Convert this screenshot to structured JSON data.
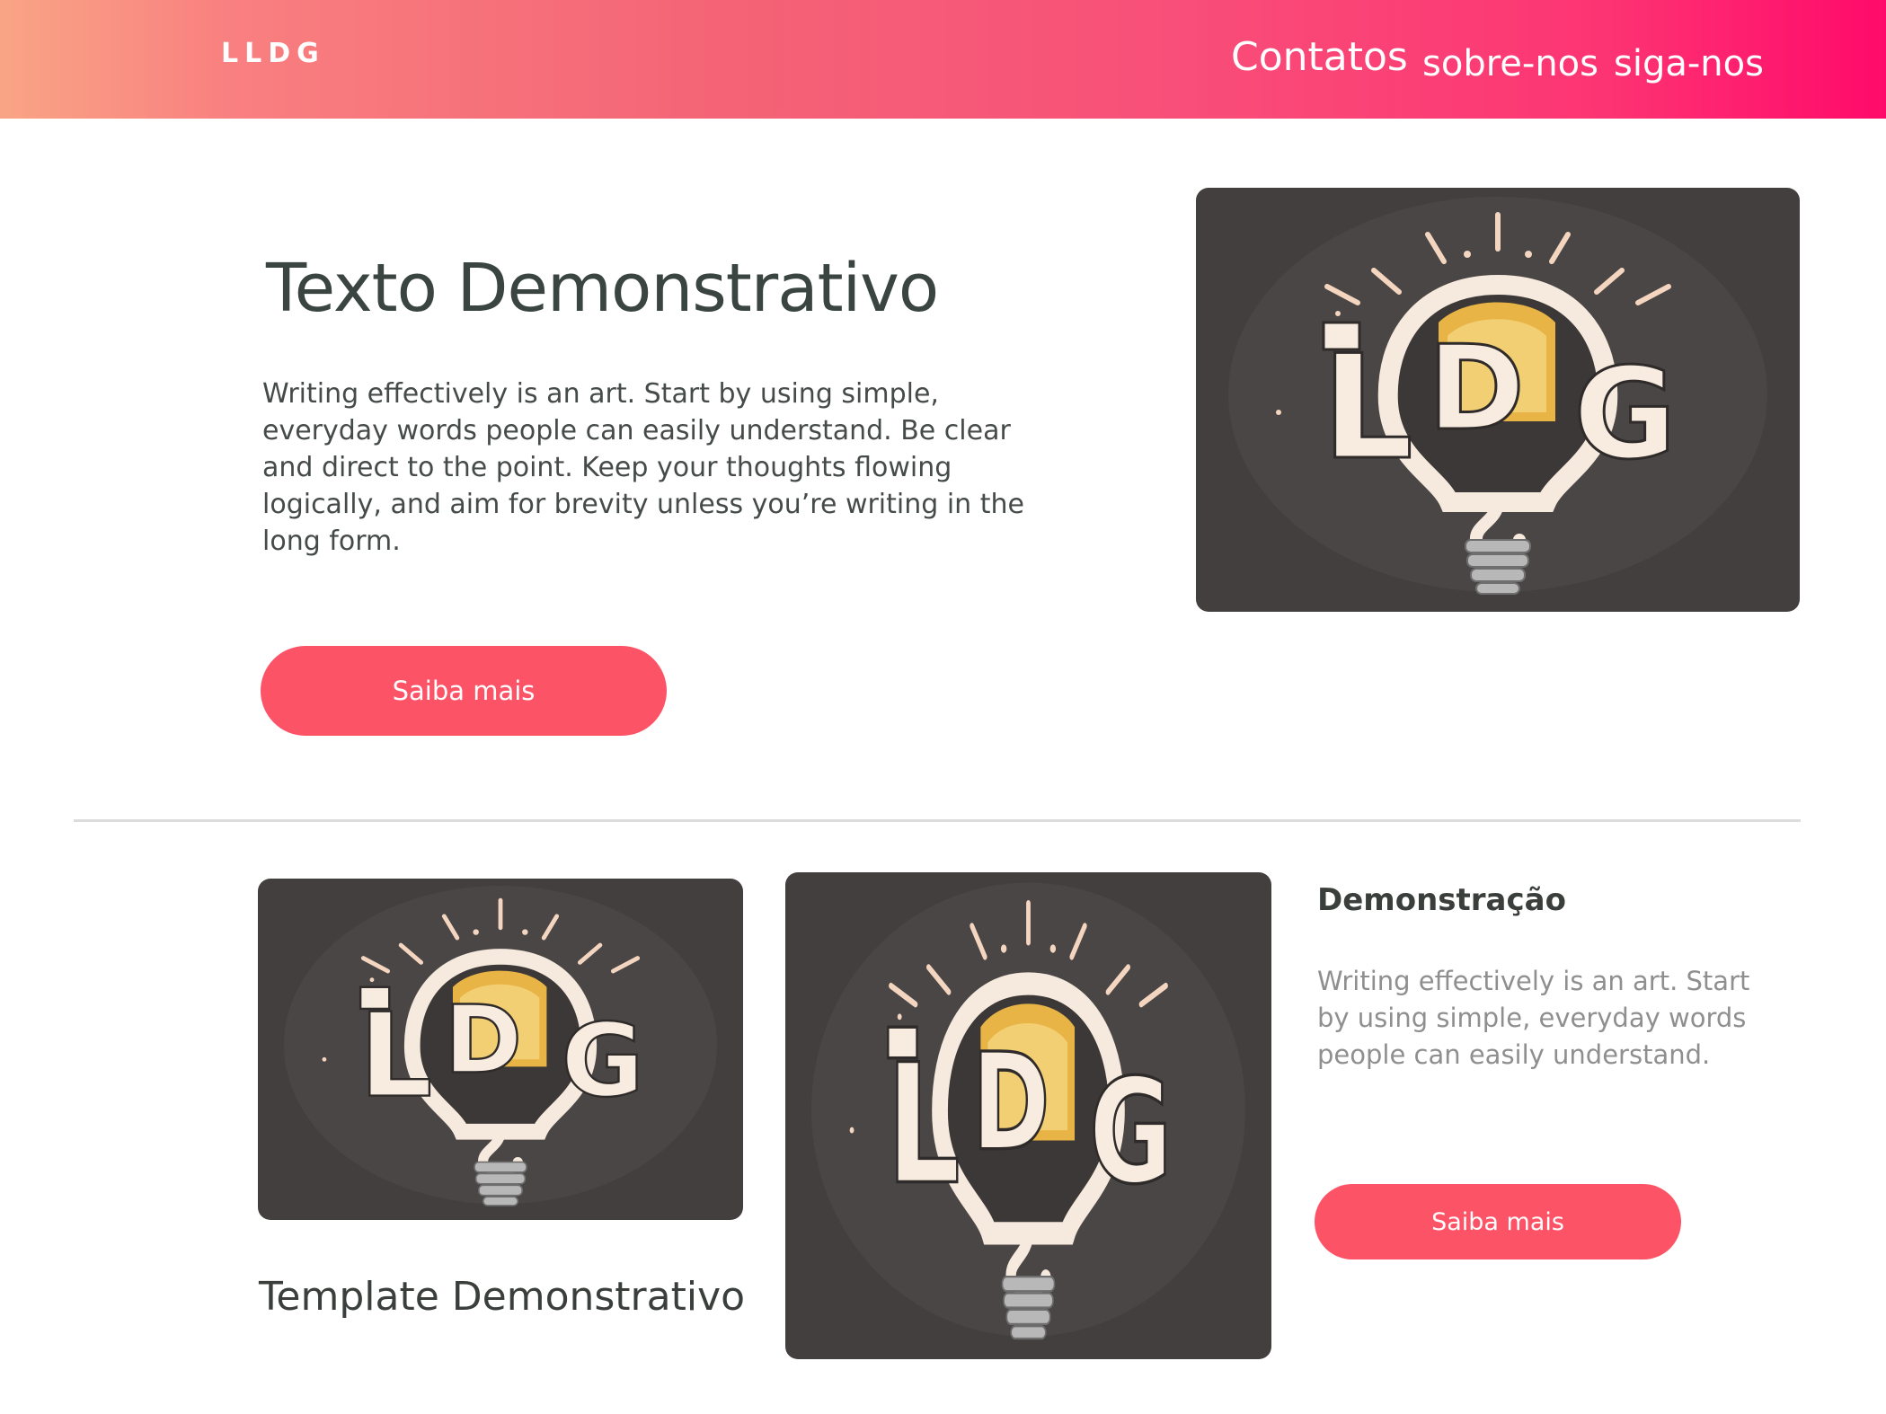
{
  "header": {
    "brand": "LLDG",
    "nav": {
      "contatos": "Contatos",
      "sobre": "sobre-nos",
      "siga": "siga-nos"
    }
  },
  "hero": {
    "title": "Texto Demonstrativo",
    "text": "Writing effectively is an art. Start by using simple, everyday words people can easily understand. Be clear and direct to the point. Keep your thoughts flowing logically, and aim for brevity unless you’re writing in the long form.",
    "button": "Saiba mais",
    "image_logo": "LLDG lightbulb logo"
  },
  "gallery": {
    "template_title": "Template Demonstrativo"
  },
  "demo": {
    "title": "Demonstração",
    "text": "Writing effectively is an art. Start by using simple, everyday words people can easily understand.",
    "button": "Saiba mais"
  },
  "colors": {
    "accent": "#fd5366",
    "header_gradient_start": "#f9a585",
    "header_gradient_end": "#ff0a6a"
  }
}
